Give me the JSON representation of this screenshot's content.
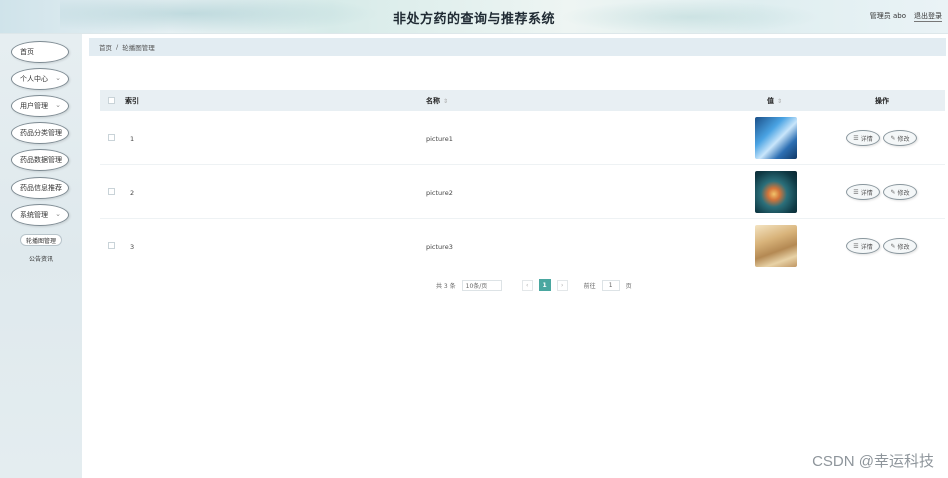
{
  "header": {
    "title": "非处方药的查询与推荐系统",
    "user_label": "管理员 abo",
    "logout_label": "退出登录"
  },
  "sidebar": {
    "items": [
      {
        "label": "首页",
        "has_chevron": false
      },
      {
        "label": "个人中心",
        "has_chevron": true
      },
      {
        "label": "用户管理",
        "has_chevron": true
      },
      {
        "label": "药品分类管理",
        "has_chevron": false
      },
      {
        "label": "药品数据管理",
        "has_chevron": false
      },
      {
        "label": "药品信息推荐",
        "has_chevron": false
      },
      {
        "label": "系统管理",
        "has_chevron": true
      }
    ],
    "subitems": [
      {
        "label": "轮播图管理",
        "active": true
      },
      {
        "label": "公告资讯",
        "active": false
      }
    ]
  },
  "breadcrumb": {
    "home": "首页",
    "separator": "/",
    "current": "轮播图管理"
  },
  "table": {
    "columns": {
      "index": "索引",
      "name": "名称",
      "value": "值",
      "actions": "操作"
    },
    "rows": [
      {
        "index": "1",
        "name": "picture1",
        "thumb": "thumb1"
      },
      {
        "index": "2",
        "name": "picture2",
        "thumb": "thumb2"
      },
      {
        "index": "3",
        "name": "picture3",
        "thumb": "thumb3"
      }
    ],
    "detail_label": "详情",
    "edit_label": "修改"
  },
  "pagination": {
    "total": "共 3 条",
    "page_size": "10条/页",
    "prev": "‹",
    "current_page": "1",
    "next": "›",
    "goto_label": "前往",
    "goto_value": "1",
    "page_suffix": "页"
  },
  "watermark": "CSDN @幸运科技",
  "colors": {
    "accent": "#4aa7a0",
    "sidebar_bg": "#e2ebee",
    "header_bg": "#dbeaec"
  }
}
